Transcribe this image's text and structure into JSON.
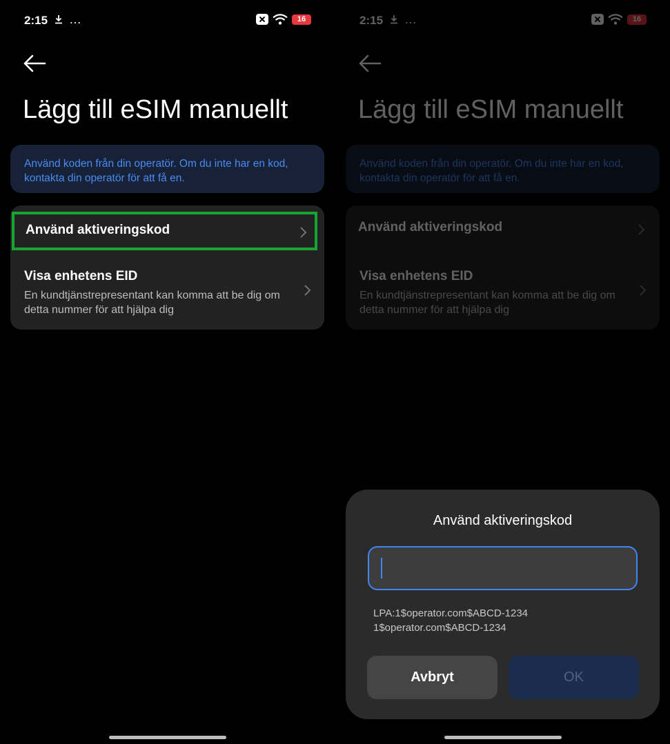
{
  "status_bar": {
    "time": "2:15",
    "more": "…",
    "battery_level": "16",
    "battery_color": "#e5393f"
  },
  "header": {
    "title": "Lägg till eSIM manuellt"
  },
  "info": {
    "text": "Använd koden från din operatör. Om du inte har en kod, kontakta din operatör för att få en."
  },
  "options": {
    "activation_code": {
      "title": "Använd aktiveringskod"
    },
    "eid": {
      "title": "Visa enhetens EID",
      "subtitle": "En kundtjänstrepresentant kan komma att be dig om detta nummer för att hjälpa dig"
    }
  },
  "dialog": {
    "title": "Använd aktiveringskod",
    "input_value": "",
    "hint_line1": "LPA:1$operator.com$ABCD-1234",
    "hint_line2": "1$operator.com$ABCD-1234",
    "cancel_label": "Avbryt",
    "ok_label": "OK"
  },
  "colors": {
    "accent": "#3f86f5",
    "highlight": "#17a532",
    "info_text": "#4a8bf0",
    "info_bg": "#172238"
  }
}
